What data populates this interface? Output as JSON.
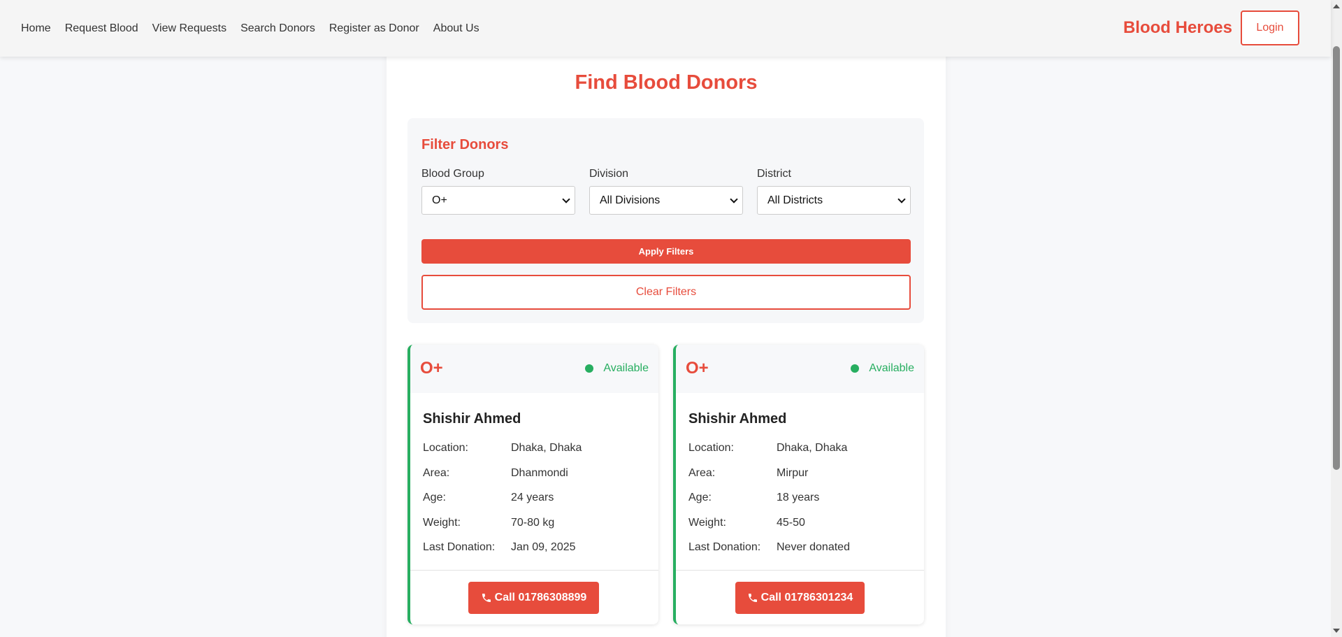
{
  "nav": {
    "links": [
      "Home",
      "Request Blood",
      "View Requests",
      "Search Donors",
      "Register as Donor",
      "About Us"
    ],
    "brand": "Blood Heroes",
    "login": "Login"
  },
  "page": {
    "title": "Find Blood Donors"
  },
  "filters": {
    "heading": "Filter Donors",
    "blood_group_label": "Blood Group",
    "blood_group_value": "O+",
    "division_label": "Division",
    "division_value": "All Divisions",
    "district_label": "District",
    "district_value": "All Districts",
    "apply_label": "Apply Filters",
    "clear_label": "Clear Filters"
  },
  "labels": {
    "location": "Location:",
    "area": "Area:",
    "age": "Age:",
    "weight": "Weight:",
    "last_donation": "Last Donation:"
  },
  "donors": [
    {
      "blood_group": "O+",
      "status": "Available",
      "name": "Shishir Ahmed",
      "location": "Dhaka, Dhaka",
      "area": "Dhanmondi",
      "age": "24 years",
      "weight": "70-80 kg",
      "last_donation": "Jan 09, 2025",
      "call": "Call 01786308899"
    },
    {
      "blood_group": "O+",
      "status": "Available",
      "name": "Shishir Ahmed",
      "location": "Dhaka, Dhaka",
      "area": "Mirpur",
      "age": "18 years",
      "weight": "45-50",
      "last_donation": "Never donated",
      "call": "Call 01786301234"
    }
  ],
  "colors": {
    "accent": "#e74c3c",
    "available": "#27ae60",
    "page_bg": "#f7f8fa"
  }
}
